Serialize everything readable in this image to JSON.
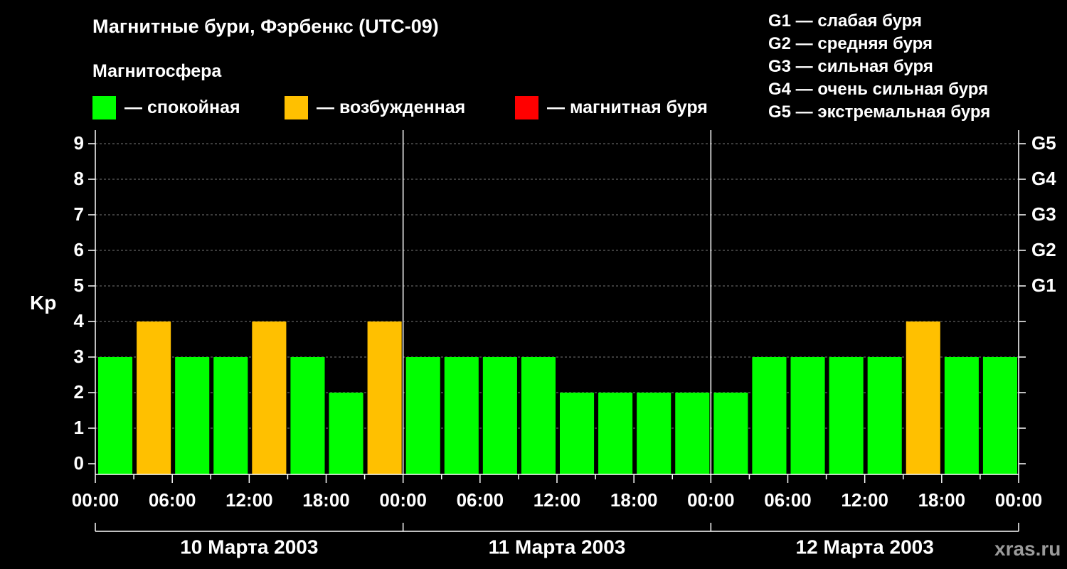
{
  "title": "Магнитные бури, Фэрбенкс (UTC-09)",
  "subtitle": "Магнитосфера",
  "legend": [
    {
      "label": "— спокойная",
      "color": "#00ff00"
    },
    {
      "label": "— возбужденная",
      "color": "#ffc000"
    },
    {
      "label": "— магнитная буря",
      "color": "#ff0000"
    }
  ],
  "g_legend": [
    "G1 — слабая буря",
    "G2 — средняя буря",
    "G3 — сильная буря",
    "G4 — очень сильная буря",
    "G5 — экстремальная буря"
  ],
  "watermark": "xras.ru",
  "chart_data": {
    "type": "bar",
    "ylabel": "Kp",
    "ylim": [
      0,
      9
    ],
    "y_ticks": [
      "0",
      "1",
      "2",
      "3",
      "4",
      "5",
      "6",
      "7",
      "8",
      "9"
    ],
    "right_axis_labels": [
      {
        "y": 5,
        "label": "G1"
      },
      {
        "y": 6,
        "label": "G2"
      },
      {
        "y": 7,
        "label": "G3"
      },
      {
        "y": 8,
        "label": "G4"
      },
      {
        "y": 9,
        "label": "G5"
      }
    ],
    "x_tick_labels": [
      "00:00",
      "06:00",
      "12:00",
      "18:00",
      "00:00",
      "06:00",
      "12:00",
      "18:00",
      "00:00",
      "06:00",
      "12:00",
      "18:00",
      "00:00"
    ],
    "days": [
      "10 Марта 2003",
      "11 Марта 2003",
      "12 Марта 2003"
    ],
    "values": [
      3,
      4,
      3,
      3,
      4,
      3,
      2,
      4,
      3,
      3,
      3,
      3,
      2,
      2,
      2,
      2,
      2,
      3,
      3,
      3,
      3,
      4,
      3,
      3
    ],
    "colors": {
      "quiet": "#00ff00",
      "active": "#ffc000",
      "storm": "#ff0000"
    },
    "grid": true
  }
}
